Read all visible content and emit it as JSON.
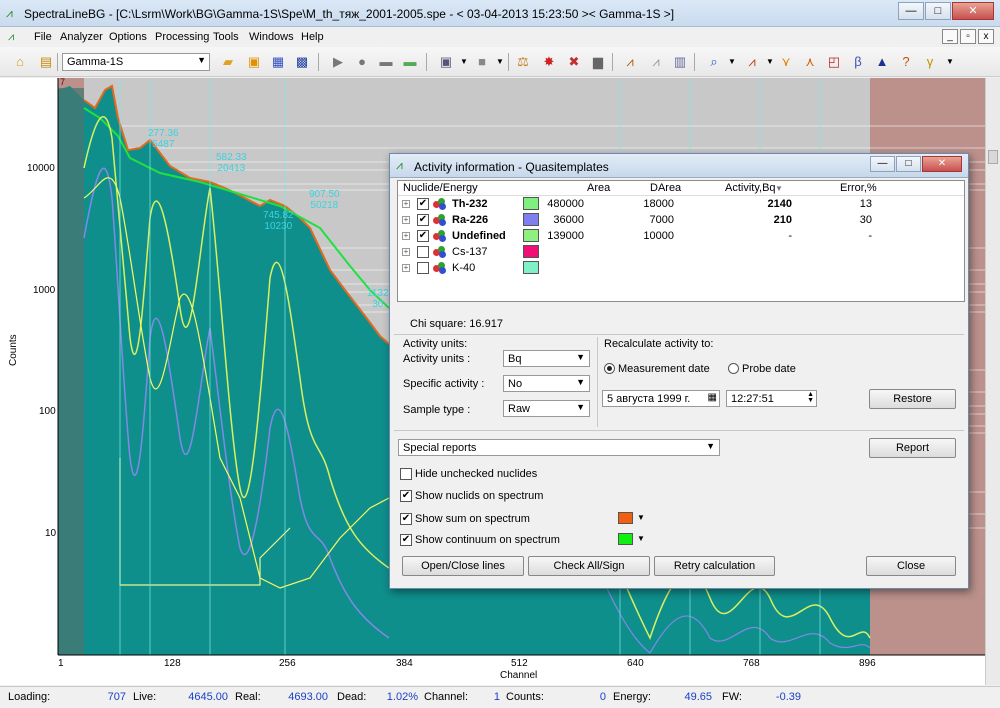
{
  "window": {
    "title": "SpectraLineBG - [C:\\Lsrm\\Work\\BG\\Gamma-1S\\Spe\\M_th_тяж_2001-2005.spe - < 03-04-2013 15:23:50 >< Gamma-1S >]",
    "min": "—",
    "max": "□",
    "close": "✕"
  },
  "menu": {
    "items": [
      "File",
      "Analyzer",
      "Options",
      "Processing",
      "Tools",
      "Windows",
      "Help"
    ],
    "mdi_min": "_",
    "mdi_restore": "▫",
    "mdi_close": "x"
  },
  "toolbar": {
    "detector_select": "Gamma-1S",
    "dropdown_arrow": "▼"
  },
  "plot": {
    "y_label": "Counts",
    "x_label": "Channel",
    "y_ticks": [
      "10000",
      "1000",
      "100",
      "10"
    ],
    "x_ticks": [
      "1",
      "128",
      "256",
      "384",
      "512",
      "640",
      "768",
      "896"
    ],
    "peak_labels": [
      {
        "energy": "277.36",
        "value": "5487"
      },
      {
        "energy": "582.33",
        "value": "20413"
      },
      {
        "energy": "745.82",
        "value": "10230"
      },
      {
        "energy": "907.50",
        "value": "50218"
      },
      {
        "energy": "1132",
        "value": "30"
      }
    ],
    "roi_marker": "7"
  },
  "dialog": {
    "title": "Activity information - Quasitemplates",
    "columns": {
      "nuclide": "Nuclide/Energy",
      "area": "Area",
      "darea": "DArea",
      "activity": "Activity,Bq",
      "sort_arrow": "▼",
      "error": "Error,%"
    },
    "rows": [
      {
        "name": "Th-232",
        "checked": true,
        "bold": true,
        "color": "#7ff07f",
        "area": "480000",
        "darea": "18000",
        "activity": "2140",
        "error": "13"
      },
      {
        "name": "Ra-226",
        "checked": true,
        "bold": true,
        "color": "#7f7ff0",
        "area": "36000",
        "darea": "7000",
        "activity": "210",
        "error": "30"
      },
      {
        "name": "Undefined",
        "checked": true,
        "bold": true,
        "color": "#8ff07f",
        "area": "139000",
        "darea": "10000",
        "activity": "-",
        "error": "-"
      },
      {
        "name": "Cs-137",
        "checked": false,
        "bold": false,
        "color": "#f01075",
        "area": "",
        "darea": "",
        "activity": "",
        "error": ""
      },
      {
        "name": "K-40",
        "checked": false,
        "bold": false,
        "color": "#7ff0c8",
        "area": "",
        "darea": "",
        "activity": "",
        "error": ""
      }
    ],
    "chi_square": "Chi square: 16.917",
    "activity_units": {
      "group": "Activity units:",
      "units_label": "Activity units :",
      "units_value": "Bq",
      "specific_label": "Specific activity :",
      "specific_value": "No",
      "sample_label": "Sample type :",
      "sample_value": "Raw"
    },
    "recalc": {
      "group": "Recalculate activity to:",
      "measurement": "Measurement date",
      "probe": "Probe date",
      "date": "5  августа  1999 г.",
      "time": "12:27:51",
      "restore": "Restore"
    },
    "reports": {
      "select": "Special reports",
      "button": "Report"
    },
    "options": [
      {
        "label": "Hide unchecked nuclides",
        "checked": false
      },
      {
        "label": "Show nuclids on spectrum",
        "checked": true
      },
      {
        "label": "Show sum on spectrum",
        "checked": true,
        "color": "#f06010"
      },
      {
        "label": "Show continuum on spectrum",
        "checked": true,
        "color": "#10f010"
      }
    ],
    "buttons": {
      "open_close": "Open/Close lines",
      "check_all": "Check All/Sign",
      "retry": "Retry calculation",
      "close": "Close"
    }
  },
  "status": {
    "loading_label": "Loading:",
    "loading": "707",
    "live_label": "Live:",
    "live": "4645.00",
    "real_label": "Real:",
    "real": "4693.00",
    "dead_label": "Dead:",
    "dead": "1.02%",
    "channel_label": "Channel:",
    "channel": "1",
    "counts_label": "Counts:",
    "counts": "0",
    "energy_label": "Energy:",
    "energy": "49.65",
    "fw_label": "FW:",
    "fw": "-0.39"
  }
}
